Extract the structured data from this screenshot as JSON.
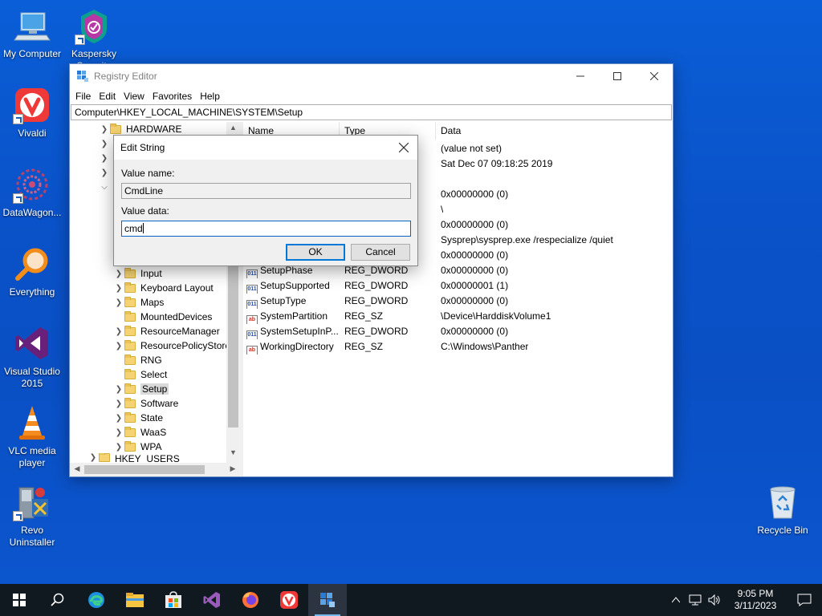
{
  "desktop": {
    "icons": [
      {
        "label": "My Computer"
      },
      {
        "label": "Kaspersky Security"
      },
      {
        "label": "Vivaldi"
      },
      {
        "label": "DataWagon..."
      },
      {
        "label": "Everything"
      },
      {
        "label": "Visual Studio 2015"
      },
      {
        "label": "VLC media player"
      },
      {
        "label": "Revo Uninstaller"
      },
      {
        "label": "Recycle Bin"
      }
    ]
  },
  "regedit": {
    "title": "Registry Editor",
    "menu": [
      "File",
      "Edit",
      "View",
      "Favorites",
      "Help"
    ],
    "address": "Computer\\HKEY_LOCAL_MACHINE\\SYSTEM\\Setup",
    "tree": [
      {
        "label": "HARDWARE"
      },
      {
        "label": "Input"
      },
      {
        "label": "Keyboard Layout"
      },
      {
        "label": "Maps"
      },
      {
        "label": "MountedDevices"
      },
      {
        "label": "ResourceManager"
      },
      {
        "label": "ResourcePolicyStore"
      },
      {
        "label": "RNG"
      },
      {
        "label": "Select"
      },
      {
        "label": "Setup"
      },
      {
        "label": "Software"
      },
      {
        "label": "State"
      },
      {
        "label": "WaaS"
      },
      {
        "label": "WPA"
      },
      {
        "label": "HKEY_USERS"
      }
    ],
    "columns": {
      "name": "Name",
      "type": "Type",
      "data": "Data"
    },
    "rows_hidden_data": [
      "(value not set)",
      "Sat Dec 07 09:18:25 2019",
      "0x00000000 (0)",
      "\\",
      "0x00000000 (0)",
      "Sysprep\\sysprep.exe /respecialize /quiet",
      "0x00000000 (0)"
    ],
    "rows": [
      {
        "name": "SetupPhase",
        "type": "REG_DWORD",
        "data": "0x00000000 (0)",
        "kind": "dword"
      },
      {
        "name": "SetupSupported",
        "type": "REG_DWORD",
        "data": "0x00000001 (1)",
        "kind": "dword"
      },
      {
        "name": "SetupType",
        "type": "REG_DWORD",
        "data": "0x00000000 (0)",
        "kind": "dword"
      },
      {
        "name": "SystemPartition",
        "type": "REG_SZ",
        "data": "\\Device\\HarddiskVolume1",
        "kind": "sz"
      },
      {
        "name": "SystemSetupInP...",
        "type": "REG_DWORD",
        "data": "0x00000000 (0)",
        "kind": "dword"
      },
      {
        "name": "WorkingDirectory",
        "type": "REG_SZ",
        "data": "C:\\Windows\\Panther",
        "kind": "sz"
      }
    ]
  },
  "dialog": {
    "title": "Edit String",
    "value_name_label": "Value name:",
    "value_name": "CmdLine",
    "value_data_label": "Value data:",
    "value_data": "cmd",
    "ok": "OK",
    "cancel": "Cancel"
  },
  "taskbar": {
    "time": "9:05 PM",
    "date": "3/11/2023"
  },
  "icon_names": {
    "dword_badge": "011",
    "sz_badge": "ab"
  }
}
